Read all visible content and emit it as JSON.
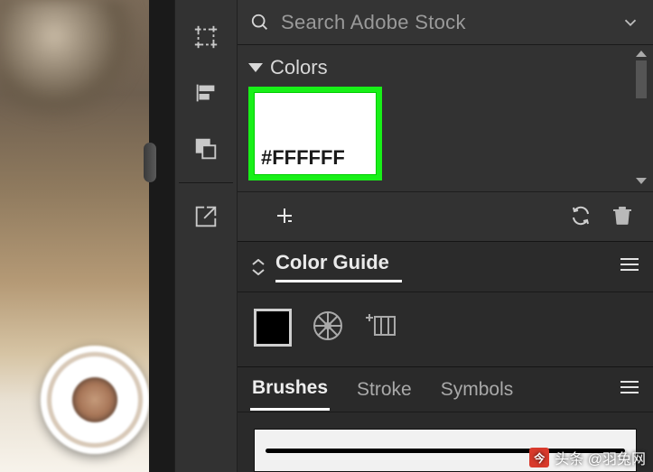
{
  "search": {
    "placeholder": "Search Adobe Stock"
  },
  "colors": {
    "section_label": "Colors",
    "swatch_hex": "#FFFFFF"
  },
  "guide": {
    "title": "Color Guide"
  },
  "tabs": {
    "brushes": "Brushes",
    "stroke": "Stroke",
    "symbols": "Symbols"
  },
  "watermark": {
    "text": "头条 @羽兔网",
    "logo_glyph": "今"
  }
}
